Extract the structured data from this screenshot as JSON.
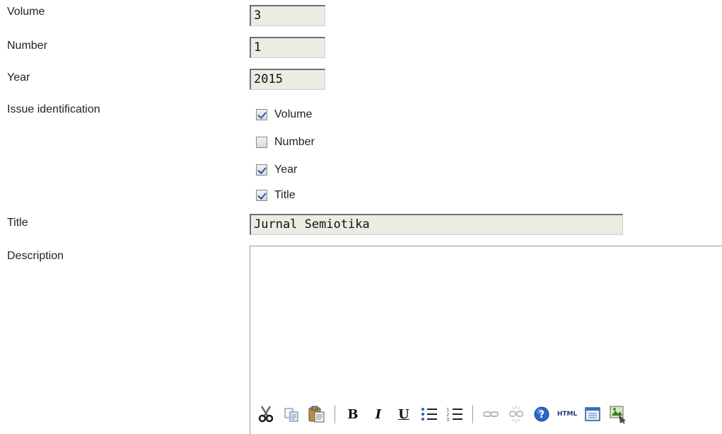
{
  "form": {
    "volume_label": "Volume",
    "volume_value": "3",
    "number_label": "Number",
    "number_value": "1",
    "year_label": "Year",
    "year_value": "2015",
    "issue_identification_label": "Issue identification",
    "issue_identification_options": [
      {
        "label": "Volume",
        "checked": true
      },
      {
        "label": "Number",
        "checked": false
      },
      {
        "label": "Year",
        "checked": true
      },
      {
        "label": "Title",
        "checked": true
      }
    ],
    "title_label": "Title",
    "title_value": "Jurnal Semiotika",
    "description_label": "Description",
    "description_value": ""
  },
  "toolbar": {
    "bold": "B",
    "italic": "I",
    "underline": "U",
    "html": "HTML",
    "icons": [
      "cut-icon",
      "copy-icon",
      "paste-icon",
      "bold-icon",
      "italic-icon",
      "underline-icon",
      "bullet-list-icon",
      "numbered-list-icon",
      "link-icon",
      "unlink-icon",
      "help-icon",
      "html-icon",
      "fullscreen-icon",
      "image-icon"
    ]
  }
}
